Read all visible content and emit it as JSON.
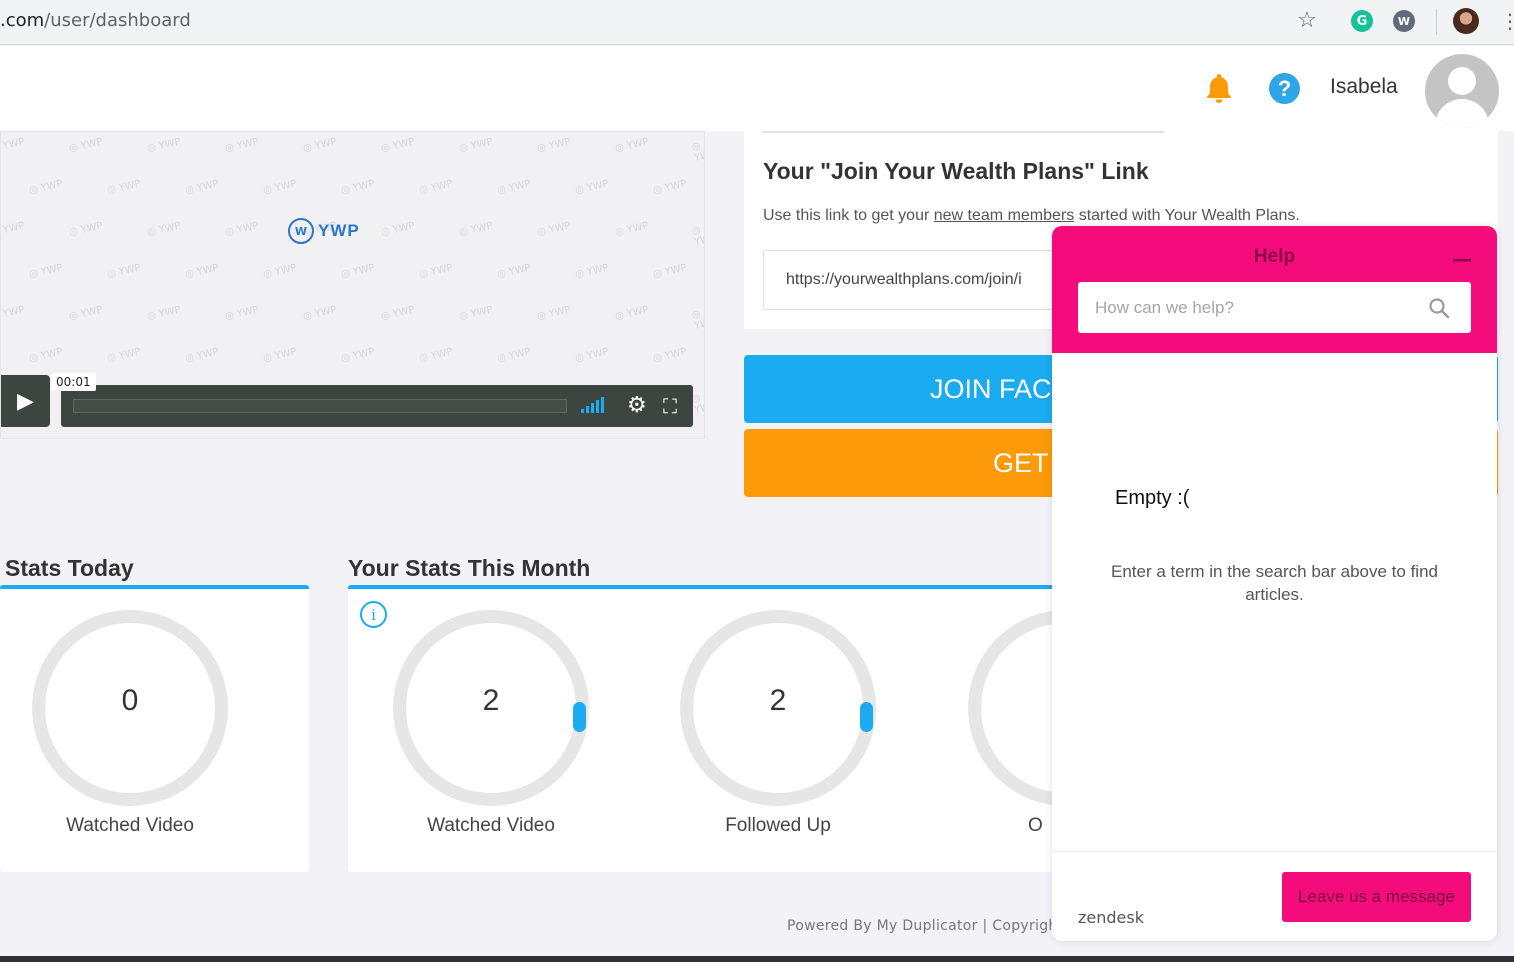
{
  "browser": {
    "url_domain": ".com",
    "url_path": "/user/dashboard",
    "icons": [
      "star-icon",
      "grammarly-icon",
      "extension-w-icon",
      "profile-avatar-icon",
      "kebab-menu-icon"
    ]
  },
  "header": {
    "username": "Isabela",
    "help_glyph": "?",
    "colors": {
      "bell": "#fc9a0a",
      "help": "#2ea6e8"
    }
  },
  "video": {
    "logo_text": "YWP",
    "watermark_text": "YWP",
    "timecode": "00:01",
    "play_glyph": "▶"
  },
  "link_card": {
    "title": "Your \"Join Your Wealth Plans\" Link",
    "desc_before": "Use this link to get your ",
    "desc_link": "new team members",
    "desc_after": " started with Your Wealth Plans.",
    "url_value": "https://yourwealthplans.com/join/i"
  },
  "buttons": {
    "facebook": "JOIN FAC",
    "get": "GET"
  },
  "stats_today": {
    "title": "Stats Today",
    "gauges": [
      {
        "value": "0",
        "label": "Watched Video"
      }
    ]
  },
  "stats_month": {
    "title": "Your Stats This Month",
    "gauges": [
      {
        "value": "2",
        "label": "Watched Video"
      },
      {
        "value": "2",
        "label": "Followed Up"
      },
      {
        "value": "",
        "label": "O"
      }
    ]
  },
  "footer": {
    "text": "Powered By My Duplicator | Copyright"
  },
  "zendesk": {
    "title": "Help",
    "minimize_glyph": "—",
    "search_placeholder": "How can we help?",
    "empty_title": "Empty :(",
    "empty_text": "Enter a term in the search bar above to find articles.",
    "brand": "zendesk",
    "leave_message": "Leave us a message",
    "accent": "#f40c7c"
  }
}
